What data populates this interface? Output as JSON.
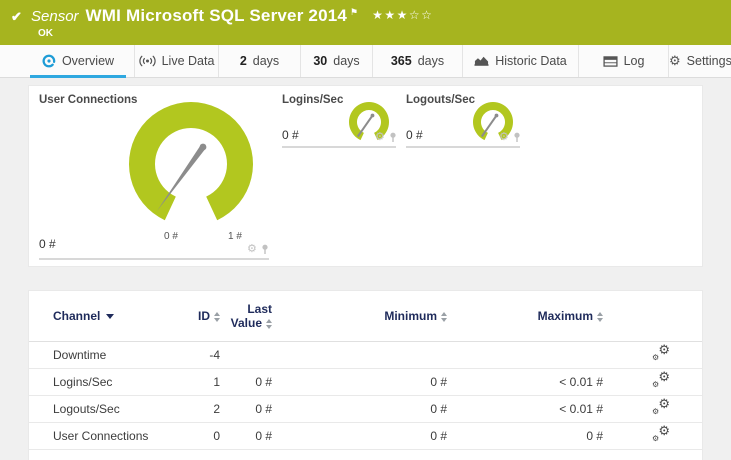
{
  "colors": {
    "header_bg": "#a6b41f",
    "accent_blue": "#2fa8e0",
    "gauge_green": "#b2c71f",
    "table_header_text": "#1f2b5b"
  },
  "icons": {
    "check": "✔",
    "flag": "⚑",
    "gear": "⚙"
  },
  "header": {
    "kind": "Sensor",
    "title": "WMI Microsoft SQL Server 2014",
    "stars": "★★★☆☆",
    "status": "OK"
  },
  "tabs": [
    {
      "label": "Overview",
      "icon": "gauge-icon",
      "active": true
    },
    {
      "label": "Live Data",
      "icon": "live-icon",
      "active": false
    },
    {
      "prefix": "2",
      "label": "days",
      "active": false
    },
    {
      "prefix": "30",
      "label": "days",
      "active": false
    },
    {
      "prefix": "365",
      "label": "days",
      "active": false
    },
    {
      "label": "Historic Data",
      "icon": "area-chart-icon",
      "active": false
    },
    {
      "label": "Log",
      "icon": "log-icon",
      "active": false
    },
    {
      "label": "Settings",
      "icon": "gear-icon",
      "active": false
    }
  ],
  "gauges": {
    "primary": {
      "title": "User Connections",
      "value": "0 #",
      "scale_min": "0 #",
      "scale_max": "1 #"
    },
    "mini": [
      {
        "title": "Logins/Sec",
        "value": "0 #"
      },
      {
        "title": "Logouts/Sec",
        "value": "0 #"
      }
    ]
  },
  "table": {
    "headers": {
      "channel": "Channel",
      "id": "ID",
      "last_value": "Last Value",
      "minimum": "Minimum",
      "maximum": "Maximum"
    },
    "rows": [
      {
        "channel": "Downtime",
        "id": "-4",
        "last_value": "",
        "minimum": "",
        "maximum": ""
      },
      {
        "channel": "Logins/Sec",
        "id": "1",
        "last_value": "0 #",
        "minimum": "0 #",
        "maximum": "< 0.01 #"
      },
      {
        "channel": "Logouts/Sec",
        "id": "2",
        "last_value": "0 #",
        "minimum": "0 #",
        "maximum": "< 0.01 #"
      },
      {
        "channel": "User Connections",
        "id": "0",
        "last_value": "0 #",
        "minimum": "0 #",
        "maximum": "0 #"
      }
    ]
  }
}
